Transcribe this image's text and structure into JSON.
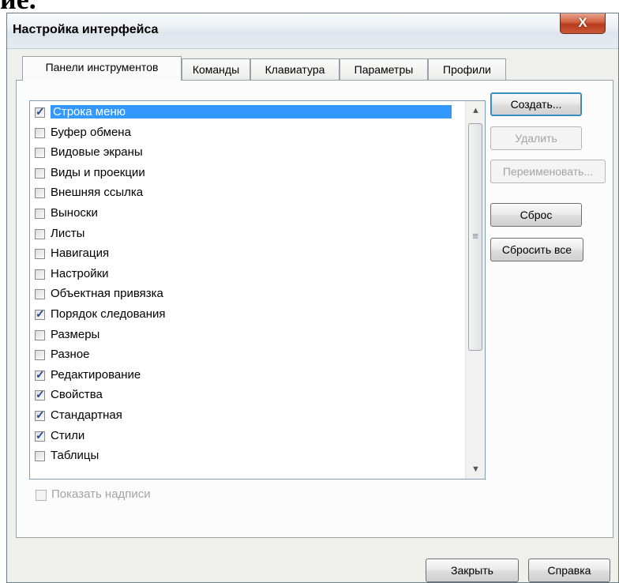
{
  "top_cut_text": "ие.",
  "window": {
    "title": "Настройка интерфейса",
    "close_glyph": "X"
  },
  "tabs": [
    {
      "label": "Панели инструментов"
    },
    {
      "label": "Команды"
    },
    {
      "label": "Клавиатура"
    },
    {
      "label": "Параметры"
    },
    {
      "label": "Профили"
    }
  ],
  "toolbar_list": [
    {
      "label": "Строка меню",
      "checked": true,
      "selected": true
    },
    {
      "label": "Буфер обмена",
      "checked": false
    },
    {
      "label": "Видовые экраны",
      "checked": false
    },
    {
      "label": "Виды и проекции",
      "checked": false
    },
    {
      "label": "Внешняя ссылка",
      "checked": false
    },
    {
      "label": "Выноски",
      "checked": false
    },
    {
      "label": "Листы",
      "checked": false
    },
    {
      "label": "Навигация",
      "checked": false
    },
    {
      "label": "Настройки",
      "checked": false
    },
    {
      "label": "Объектная привязка",
      "checked": false
    },
    {
      "label": "Порядок следования",
      "checked": true
    },
    {
      "label": "Размеры",
      "checked": false
    },
    {
      "label": "Разное",
      "checked": false
    },
    {
      "label": "Редактирование",
      "checked": true
    },
    {
      "label": "Свойства",
      "checked": true
    },
    {
      "label": "Стандартная",
      "checked": true
    },
    {
      "label": "Стили",
      "checked": true
    },
    {
      "label": "Таблицы",
      "checked": false
    }
  ],
  "side_buttons": {
    "create": "Создать...",
    "delete": "Удалить",
    "rename": "Переименовать...",
    "reset": "Сброс",
    "reset_all": "Сбросить все"
  },
  "show_labels": "Показать надписи",
  "footer": {
    "close": "Закрыть",
    "help": "Справка"
  },
  "icons": {
    "scroll_up": "scroll-up-arrow-icon",
    "scroll_down": "scroll-down-arrow-icon",
    "grip": "scroll-grip-icon",
    "checkmark": "checkmark-icon"
  },
  "colors": {
    "selection": "#3399ff",
    "close_button": "#c24a2a",
    "window_bg": "#efefec"
  }
}
